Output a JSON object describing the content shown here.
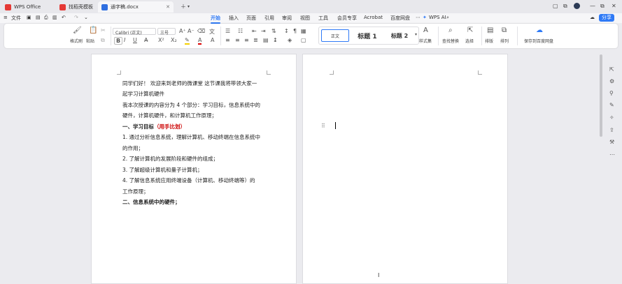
{
  "tabs": [
    {
      "label": "WPS Office",
      "icon": "wps-logo-icon",
      "color": "#e53935"
    },
    {
      "label": "找稻壳模板",
      "icon": "daoke-icon",
      "color": "#e53935"
    },
    {
      "label": "通字稿.docx",
      "icon": "word-doc-icon",
      "color": "#2f6fe0"
    }
  ],
  "menu": {
    "file": "文件",
    "items": [
      "开始",
      "插入",
      "页面",
      "引用",
      "审阅",
      "视图",
      "工具",
      "会员专享",
      "Acrobat",
      "百度网盘"
    ],
    "active": "开始",
    "wps_ai": "WPS AI",
    "share": "分享"
  },
  "ribbon": {
    "format_painter": "格式刷",
    "paste": "粘贴",
    "font_name": "Calibri (正文)",
    "font_size": "三号",
    "styles": [
      "正文",
      "标题 1",
      "标题 2"
    ],
    "style_set": "样式集",
    "find_replace": "查找替换",
    "select": "选择",
    "arrange": "排版",
    "sort": "排列",
    "save_baidu": "保存到百度网盘"
  },
  "document": {
    "lines": [
      {
        "text": "同学们好！ 欢迎来到老师的微课堂 这节课我将带领大家一",
        "style": "normal"
      },
      {
        "text": "起学习计算机硬件",
        "style": "normal"
      },
      {
        "text": "我本次授课的内容分为 4 个部分：学习目标，信息系统中的",
        "style": "normal"
      },
      {
        "text": "硬件，计算机硬件，和计算机工作原理；",
        "style": "normal"
      },
      {
        "text": "一、学习目标",
        "style": "bold",
        "extra": "（用手比划）"
      },
      {
        "text": "1. 通过分析信息系统，理解计算机、移动终端在信息系统中",
        "style": "normal"
      },
      {
        "text": "的作用；",
        "style": "normal"
      },
      {
        "text": "2. 了解计算机的发展阶段和硬件的组成；",
        "style": "normal"
      },
      {
        "text": "3. 了解超级计算机和量子计算机；",
        "style": "normal"
      },
      {
        "text": "4. 了解信息系统应用终端设备（计算机、移动终端等）的",
        "style": "normal"
      },
      {
        "text": "工作原理；",
        "style": "normal"
      },
      {
        "text": "二、信息系统中的硬件；",
        "style": "bold"
      }
    ]
  },
  "colors": {
    "accent": "#2f7af6",
    "heading_note": "#cc0000"
  }
}
